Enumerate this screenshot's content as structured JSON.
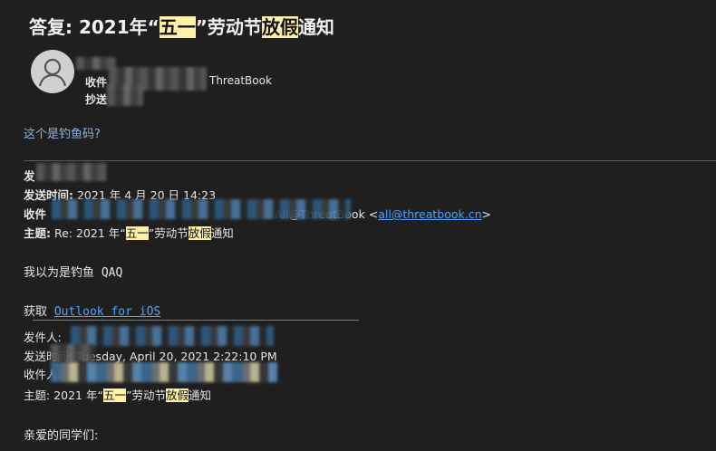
{
  "subject": {
    "prefix": "答复: 2021年“",
    "hl1": "五一",
    "mid": "”劳动节",
    "hl2": "放假",
    "suffix": "通知"
  },
  "header": {
    "to_label": "收件",
    "to_domain": "ThreatBook",
    "cc_label": "抄送"
  },
  "reply": {
    "text": "这个是钓鱼码?"
  },
  "quote1": {
    "from_label": "发",
    "time_label": "发送时间:",
    "time_value": "2021 年 4 月 20 日 14:23",
    "to_label": "收件",
    "to_tail": "All@ThreatBook <",
    "to_email": "all@threatbook.cn",
    "to_close": ">",
    "subject_label": "主题:",
    "subject_prefix": "Re: 2021 年“",
    "hl1": "五一",
    "mid": "”劳动节",
    "hl2": "放假",
    "suffix": "通知",
    "body": "我以为是钓鱼 QAQ",
    "get_label": "获取",
    "get_link": "Outlook for iOS"
  },
  "quote2": {
    "from_label": "发件人:",
    "time_label": "发送时间:",
    "time_value": "Tuesday, April 20, 2021 2:22:10 PM",
    "to_label": "收件人:",
    "subject_label": "主题:",
    "subject_prefix": "2021 年“",
    "hl1": "五一",
    "mid": "”劳动节",
    "hl2": "放假",
    "suffix": "通知",
    "greeting": "亲爱的同学们:"
  }
}
